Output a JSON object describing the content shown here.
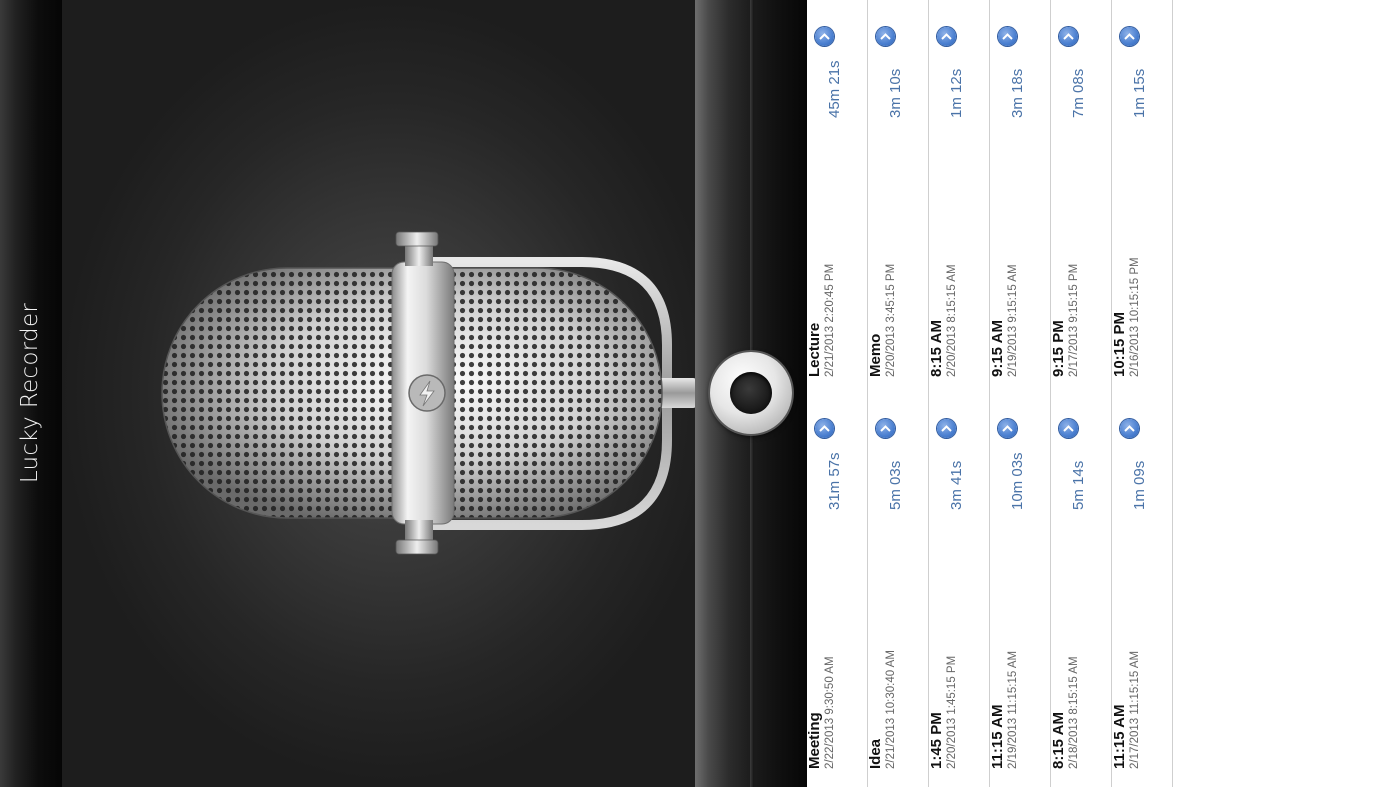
{
  "app": {
    "title": "Lucky Recorder"
  },
  "colors": {
    "accent": "#4a7fd0",
    "duration_text": "#4a73a8"
  },
  "recordings": [
    {
      "name": "Meeting",
      "date": "2/22/2013 9:30:50 AM",
      "duration": "31m 57s"
    },
    {
      "name": "Lecture",
      "date": "2/21/2013 2:20:45 PM",
      "duration": "45m 21s"
    },
    {
      "name": "Idea",
      "date": "2/21/2013 10:30:40 AM",
      "duration": "5m 03s"
    },
    {
      "name": "Memo",
      "date": "2/20/2013 3:45:15 PM",
      "duration": "3m 10s"
    },
    {
      "name": "1:45 PM",
      "date": "2/20/2013 1:45:15 PM",
      "duration": "3m 41s"
    },
    {
      "name": "8:15 AM",
      "date": "2/20/2013 8:15:15 AM",
      "duration": "1m 12s"
    },
    {
      "name": "11:15 AM",
      "date": "2/19/2013 11:15:15 AM",
      "duration": "10m 03s"
    },
    {
      "name": "9:15 AM",
      "date": "2/19/2013 9:15:15 AM",
      "duration": "3m 18s"
    },
    {
      "name": "8:15 AM",
      "date": "2/18/2013 8:15:15 AM",
      "duration": "5m 14s"
    },
    {
      "name": "9:15 PM",
      "date": "2/17/2013 9:15:15 PM",
      "duration": "7m 08s"
    },
    {
      "name": "11:15 AM",
      "date": "2/17/2013 11:15:15 AM",
      "duration": "1m 09s"
    },
    {
      "name": "10:15 PM",
      "date": "2/16/2013 10:15:15 PM",
      "duration": "1m 15s"
    }
  ]
}
